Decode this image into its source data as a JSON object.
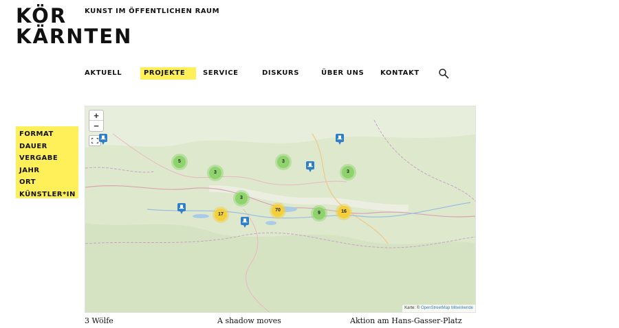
{
  "brand": {
    "logo_line1": "KÖR",
    "logo_line2": "KÄRNTEN",
    "tagline": "KUNST IM ÖFFENTLICHEN RAUM"
  },
  "nav": {
    "items": [
      "AKTUELL",
      "PROJEKTE",
      "SERVICE",
      "DISKURS",
      "ÜBER UNS",
      "KONTAKT"
    ],
    "active": "PROJEKTE",
    "search_icon": "search-icon"
  },
  "filters": [
    "FORMAT",
    "DAUER",
    "VERGABE",
    "JAHR",
    "ORT",
    "KÜNSTLER*IN"
  ],
  "map": {
    "zoom_in": "+",
    "zoom_out": "−",
    "clusters": [
      "5",
      "3",
      "3",
      "3",
      "3",
      "70",
      "17",
      "9",
      "16"
    ],
    "attribution_prefix": "Karte: ©",
    "attribution_link": "OpenStreetMap Mitwirkende",
    "colors": {
      "cluster_small": "#8fd36c",
      "cluster_medium": "#f3cf3c",
      "pin": "#2f7fc8",
      "highlight": "#fff05a"
    }
  },
  "captions": [
    "3 Wölfe",
    "A shadow moves",
    "Aktion am Hans-Gasser-Platz"
  ]
}
